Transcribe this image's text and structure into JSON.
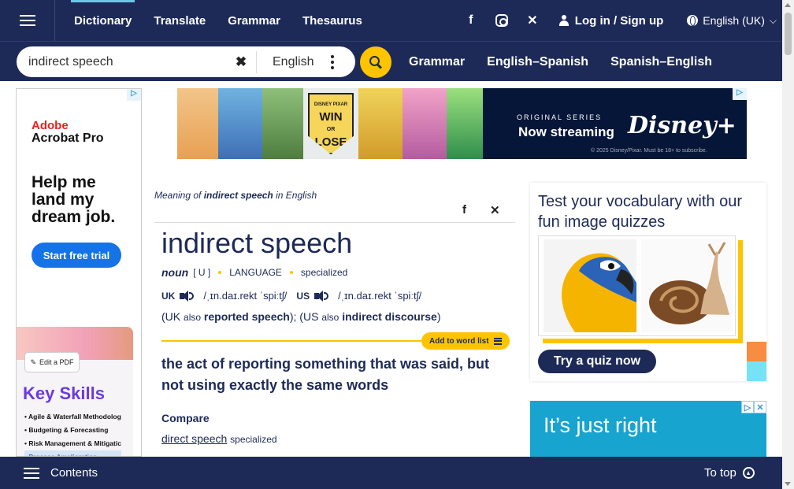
{
  "nav": {
    "items": [
      {
        "label": "Dictionary",
        "active": true
      },
      {
        "label": "Translate"
      },
      {
        "label": "Grammar"
      },
      {
        "label": "Thesaurus"
      }
    ],
    "social_icons": [
      "facebook-icon",
      "instagram-icon",
      "x-icon"
    ],
    "login_label": "Log in / Sign up",
    "language_label": "English (UK)"
  },
  "search": {
    "value": "indirect speech",
    "dictionary": "English",
    "links": [
      "Grammar",
      "English–Spanish",
      "Spanish–English"
    ]
  },
  "left_ad": {
    "brand_line1": "Adobe",
    "brand_line2": "Acrobat Pro",
    "headline": "Help me land my dream job.",
    "cta": "Start free trial",
    "chip": "Edit a PDF",
    "card_title": "Key Skills",
    "skills": [
      "Agile & Waterfall Methodolog",
      "Budgeting & Forecasting",
      "Risk Management & Mitigatic",
      "Process Amelioration"
    ]
  },
  "banner_ad": {
    "badge_top": "DISNEY PIXAR",
    "win": "WIN",
    "or": "OR",
    "lose": "LOSE",
    "series": "ORIGINAL SERIES",
    "streaming": "Now streaming",
    "brand": "Disney+",
    "disclaimer": "© 2025 Disney/Pixar. Must be 18+ to subscribe."
  },
  "entry": {
    "meaning_prefix": "Meaning of",
    "meaning_term": "indirect speech",
    "meaning_suffix": "in English",
    "headword": "indirect speech",
    "pos": "noun",
    "grammar": "[ U ]",
    "domain": "LANGUAGE",
    "register": "specialized",
    "uk_label": "UK",
    "uk_ipa": "/ˌɪn.daɪ.rekt ˈspiːtʃ/",
    "us_label": "US",
    "us_ipa": "/ˌɪn.daɪ.rekt ˈspiːtʃ/",
    "also_uk_label": "UK",
    "also_word": "also",
    "also_uk_term": "reported speech",
    "also_us_label": "US",
    "also_us_term": "indirect discourse",
    "add_to_list": "Add to word list",
    "definition": "the act of reporting something that was said, but not using exactly the same words",
    "compare_label": "Compare",
    "compare_term": "direct speech",
    "compare_register": "specialized"
  },
  "quiz": {
    "title": "Test your vocabulary with our fun image quizzes",
    "button": "Try a quiz now"
  },
  "right_ad": {
    "text": "It’s just right"
  },
  "footer": {
    "contents": "Contents",
    "to_top": "To top"
  },
  "colors": {
    "navy": "#1d2a57",
    "yellow": "#fec400",
    "adobe_blue": "#1473e6"
  }
}
